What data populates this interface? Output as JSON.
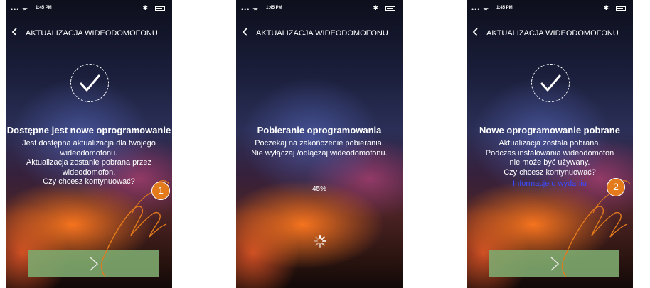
{
  "status": {
    "time": "1:45 PM"
  },
  "screens": [
    {
      "title": "AKTUALIZACJA WIDEODOMOFONU",
      "heading": "Dostępne jest nowe oprogramowanie",
      "body_lines": [
        "Jest dostępna aktualizacja dla twojego",
        "wideodomofonu.",
        "Aktualizacja zostanie pobrana przez",
        "wideodomofon.",
        "Czy chcesz kontynuować?"
      ],
      "step": "1"
    },
    {
      "title": "AKTUALIZACJA WIDEODOMOFONU",
      "heading": "Pobieranie oprogramowania",
      "body_lines": [
        "Poczekaj na zakończenie pobierania.",
        "Nie wyłączaj /odłączaj wideodomofonu."
      ],
      "progress": "45%"
    },
    {
      "title": "AKTUALIZACJA WIDEODOMOFONU",
      "heading": "Nowe oprogramowanie pobrane",
      "body_lines": [
        "Aktualizacja została pobrana.",
        "Podczas instalowania wideodomofon",
        "nie może być używany.",
        "Czy chcesz kontynuować?"
      ],
      "link": "Informacje o wydaniu",
      "step": "2"
    }
  ],
  "colors": {
    "button": "#7ea96e",
    "step_marker": "#e37a1c",
    "link": "#3b4cff"
  }
}
